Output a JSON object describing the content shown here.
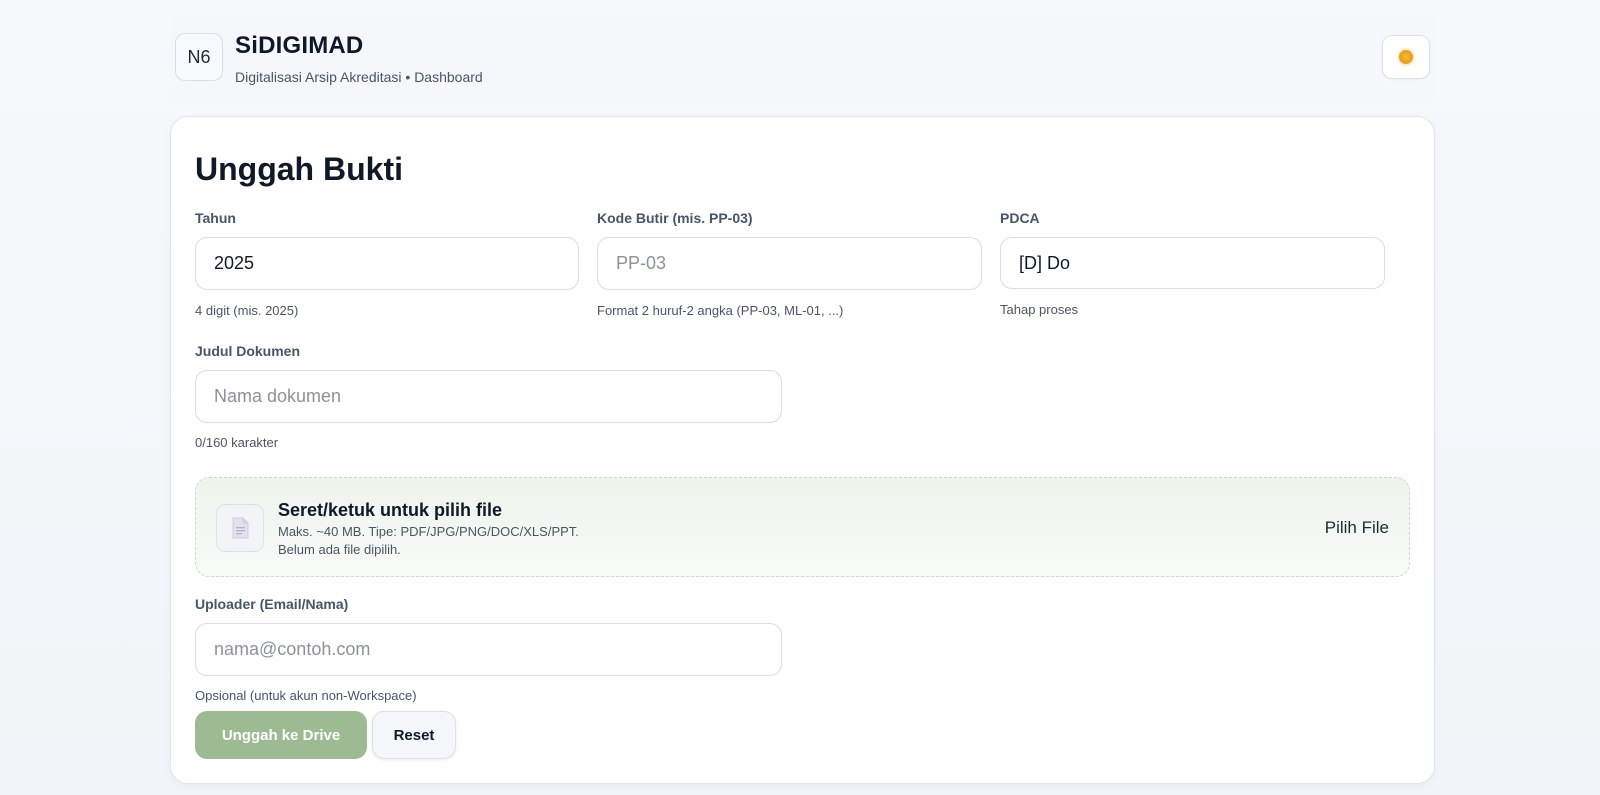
{
  "header": {
    "logo_text": "N6",
    "title": "SiDIGIMAD",
    "subtitle": "Digitalisasi Arsip Akreditasi • Dashboard",
    "theme_icon": "sun-icon"
  },
  "form": {
    "title": "Unggah Bukti",
    "tahun": {
      "label": "Tahun",
      "value": "2025",
      "hint": "4 digit (mis. 2025)"
    },
    "kode_butir": {
      "label": "Kode Butir (mis. PP-03)",
      "value": "",
      "placeholder": "PP-03",
      "hint": "Format 2 huruf-2 angka (PP-03, ML-01, ...)"
    },
    "pdca": {
      "label": "PDCA",
      "selected": "[D] Do",
      "hint": "Tahap proses"
    },
    "judul": {
      "label": "Judul Dokumen",
      "value": "",
      "placeholder": "Nama dokumen",
      "counter": "0/160 karakter"
    },
    "dropzone": {
      "icon": "document-icon",
      "title": "Seret/ketuk untuk pilih file",
      "subtitle": "Maks. ~40 MB. Tipe: PDF/JPG/PNG/DOC/XLS/PPT.",
      "status": "Belum ada file dipilih.",
      "pick_label": "Pilih File"
    },
    "uploader": {
      "label": "Uploader (Email/Nama)",
      "value": "",
      "placeholder": "nama@contoh.com",
      "hint": "Opsional (untuk akun non-Workspace)"
    },
    "actions": {
      "submit_label": "Unggah ke Drive",
      "reset_label": "Reset"
    }
  },
  "colors": {
    "primary_button": "#9dbb92",
    "theme_sun": "#f6b733"
  }
}
